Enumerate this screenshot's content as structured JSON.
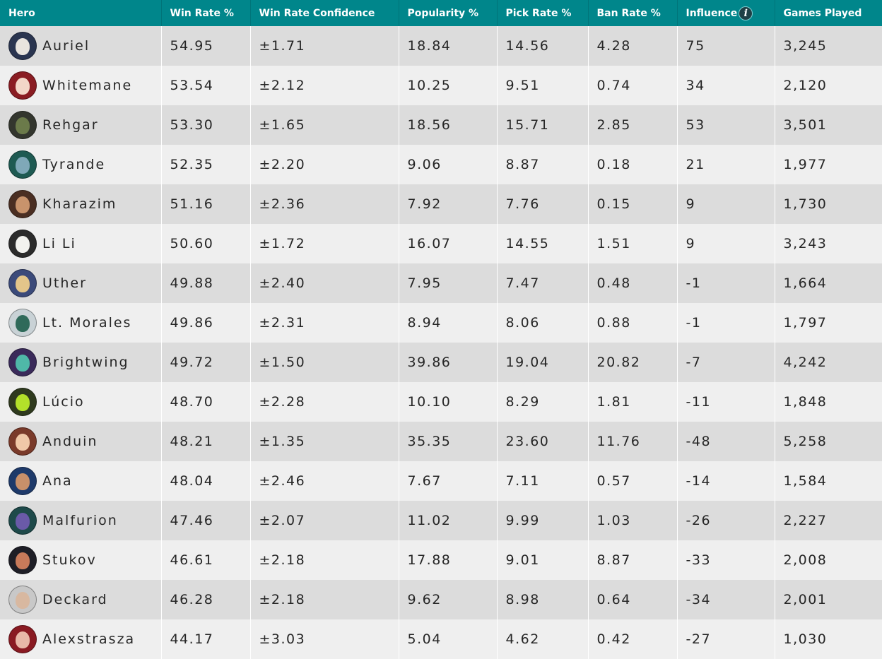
{
  "headers": [
    "Hero",
    "Win Rate %",
    "Win Rate Confidence",
    "Popularity %",
    "Pick Rate %",
    "Ban Rate %",
    "Influence",
    "Games Played"
  ],
  "influence_info_glyph": "i",
  "icons": {
    "influence_info": "info-icon"
  },
  "colors": {
    "header_bg": "#00868b",
    "header_text": "#ffffff",
    "row_odd": "#dcdcdc",
    "row_even": "#efefef"
  },
  "rows": [
    {
      "hero": "Auriel",
      "win_rate": "54.95",
      "confidence": "±1.71",
      "popularity": "18.84",
      "pick_rate": "14.56",
      "ban_rate": "4.28",
      "influence": "75",
      "games": "3,245",
      "portrait": {
        "bg": "#2a3550",
        "face": "#e8e4de"
      }
    },
    {
      "hero": "Whitemane",
      "win_rate": "53.54",
      "confidence": "±2.12",
      "popularity": "10.25",
      "pick_rate": "9.51",
      "ban_rate": "0.74",
      "influence": "34",
      "games": "2,120",
      "portrait": {
        "bg": "#8a1c22",
        "face": "#f2d7c8"
      }
    },
    {
      "hero": "Rehgar",
      "win_rate": "53.30",
      "confidence": "±1.65",
      "popularity": "18.56",
      "pick_rate": "15.71",
      "ban_rate": "2.85",
      "influence": "53",
      "games": "3,501",
      "portrait": {
        "bg": "#33362e",
        "face": "#6b7a4a"
      }
    },
    {
      "hero": "Tyrande",
      "win_rate": "52.35",
      "confidence": "±2.20",
      "popularity": "9.06",
      "pick_rate": "8.87",
      "ban_rate": "0.18",
      "influence": "21",
      "games": "1,977",
      "portrait": {
        "bg": "#1e5a52",
        "face": "#7fa8b8"
      }
    },
    {
      "hero": "Kharazim",
      "win_rate": "51.16",
      "confidence": "±2.36",
      "popularity": "7.92",
      "pick_rate": "7.76",
      "ban_rate": "0.15",
      "influence": "9",
      "games": "1,730",
      "portrait": {
        "bg": "#4a2e22",
        "face": "#c8936c"
      }
    },
    {
      "hero": "Li Li",
      "win_rate": "50.60",
      "confidence": "±1.72",
      "popularity": "16.07",
      "pick_rate": "14.55",
      "ban_rate": "1.51",
      "influence": "9",
      "games": "3,243",
      "portrait": {
        "bg": "#2b2b2b",
        "face": "#f2f2ee"
      }
    },
    {
      "hero": "Uther",
      "win_rate": "49.88",
      "confidence": "±2.40",
      "popularity": "7.95",
      "pick_rate": "7.47",
      "ban_rate": "0.48",
      "influence": "-1",
      "games": "1,664",
      "portrait": {
        "bg": "#3b4a7a",
        "face": "#e3c58a"
      }
    },
    {
      "hero": "Lt. Morales",
      "win_rate": "49.86",
      "confidence": "±2.31",
      "popularity": "8.94",
      "pick_rate": "8.06",
      "ban_rate": "0.88",
      "influence": "-1",
      "games": "1,797",
      "portrait": {
        "bg": "#c9d2d6",
        "face": "#2f6a5a"
      }
    },
    {
      "hero": "Brightwing",
      "win_rate": "49.72",
      "confidence": "±1.50",
      "popularity": "39.86",
      "pick_rate": "19.04",
      "ban_rate": "20.82",
      "influence": "-7",
      "games": "4,242",
      "portrait": {
        "bg": "#3a2a5a",
        "face": "#4fb8a8"
      }
    },
    {
      "hero": "Lúcio",
      "win_rate": "48.70",
      "confidence": "±2.28",
      "popularity": "10.10",
      "pick_rate": "8.29",
      "ban_rate": "1.81",
      "influence": "-11",
      "games": "1,848",
      "portrait": {
        "bg": "#2f3a1e",
        "face": "#b3e02a"
      }
    },
    {
      "hero": "Anduin",
      "win_rate": "48.21",
      "confidence": "±1.35",
      "popularity": "35.35",
      "pick_rate": "23.60",
      "ban_rate": "11.76",
      "influence": "-48",
      "games": "5,258",
      "portrait": {
        "bg": "#7a3a2a",
        "face": "#f0c8a8"
      }
    },
    {
      "hero": "Ana",
      "win_rate": "48.04",
      "confidence": "±2.46",
      "popularity": "7.67",
      "pick_rate": "7.11",
      "ban_rate": "0.57",
      "influence": "-14",
      "games": "1,584",
      "portrait": {
        "bg": "#1e3a6a",
        "face": "#c8906a"
      }
    },
    {
      "hero": "Malfurion",
      "win_rate": "47.46",
      "confidence": "±2.07",
      "popularity": "11.02",
      "pick_rate": "9.99",
      "ban_rate": "1.03",
      "influence": "-26",
      "games": "2,227",
      "portrait": {
        "bg": "#1e4a4a",
        "face": "#6a5aa8"
      }
    },
    {
      "hero": "Stukov",
      "win_rate": "46.61",
      "confidence": "±2.18",
      "popularity": "17.88",
      "pick_rate": "9.01",
      "ban_rate": "8.87",
      "influence": "-33",
      "games": "2,008",
      "portrait": {
        "bg": "#1e1e26",
        "face": "#c87a5a"
      }
    },
    {
      "hero": "Deckard",
      "win_rate": "46.28",
      "confidence": "±2.18",
      "popularity": "9.62",
      "pick_rate": "8.98",
      "ban_rate": "0.64",
      "influence": "-34",
      "games": "2,001",
      "portrait": {
        "bg": "#c8c8c8",
        "face": "#d8b8a0"
      }
    },
    {
      "hero": "Alexstrasza",
      "win_rate": "44.17",
      "confidence": "±3.03",
      "popularity": "5.04",
      "pick_rate": "4.62",
      "ban_rate": "0.42",
      "influence": "-27",
      "games": "1,030",
      "portrait": {
        "bg": "#8a1a22",
        "face": "#e8b8a8"
      }
    }
  ]
}
